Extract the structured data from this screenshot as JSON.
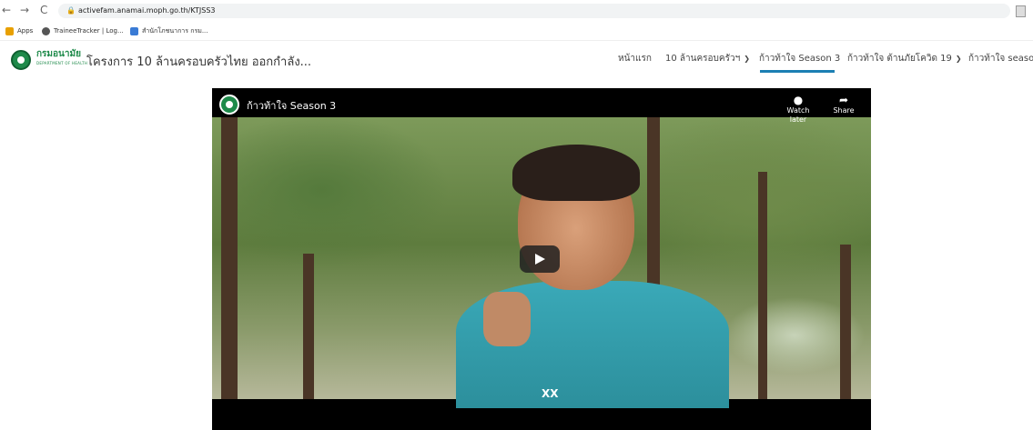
{
  "browser": {
    "back_icon": "←",
    "forward_icon": "→",
    "reload_icon": "C",
    "lock_icon": "🔒",
    "url": "activefam.anamai.moph.go.th/KTJSS3"
  },
  "bookmarks": [
    {
      "label": "Apps",
      "icon": "apps-grid-icon",
      "color": "#e8a000"
    },
    {
      "label": "TraineeTracker | Log...",
      "icon": "globe-icon",
      "color": "#555555"
    },
    {
      "label": "สำนักโภชนาการ กรม...",
      "icon": "site-icon",
      "color": "#3a7bd5"
    }
  ],
  "site": {
    "logo_text": "กรมอนามัย",
    "logo_sub": "DEPARTMENT OF HEALTH",
    "title": "โครงการ 10 ล้านครอบครัวไทย ออกกำลัง..."
  },
  "nav": [
    {
      "label": "หน้าแรก",
      "has_dropdown": false
    },
    {
      "label": "10 ล้านครอบครัวฯ",
      "has_dropdown": true
    },
    {
      "label": "ก้าวท้าใจ Season 3",
      "has_dropdown": false,
      "active": true
    },
    {
      "label": "ก้าวท้าใจ ต้านภัยโควิด 19",
      "has_dropdown": true
    },
    {
      "label": "ก้าวท้าใจ seaso",
      "has_dropdown": false
    }
  ],
  "video": {
    "title": "ก้าวท้าใจ Season 3",
    "watch_later": "Watch later",
    "share": "Share",
    "watch_later_icon": "clock-icon",
    "share_icon": "share-arrow-icon",
    "shirt_logo": "XX"
  },
  "colors": {
    "accent_underline": "#1b7fb3",
    "brand_green": "#1e8a4a"
  }
}
